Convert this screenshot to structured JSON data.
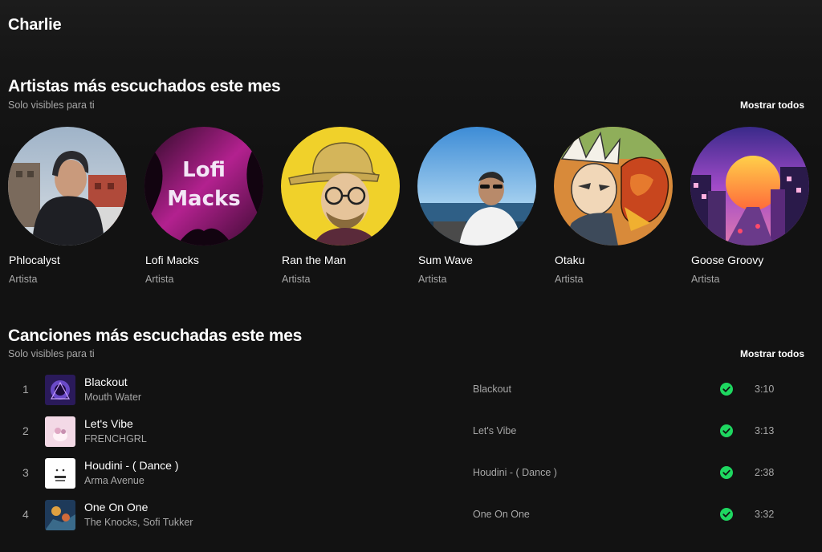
{
  "header": {
    "title": "Charlie"
  },
  "top_artists": {
    "title": "Artistas más escuchados este mes",
    "subtitle": "Solo visibles para ti",
    "show_all": "Mostrar todos",
    "items": [
      {
        "name": "Phlocalyst",
        "type": "Artista"
      },
      {
        "name": "Lofi Macks",
        "type": "Artista",
        "logo_text": [
          "Lofi",
          "Macks"
        ]
      },
      {
        "name": "Ran the Man",
        "type": "Artista"
      },
      {
        "name": "Sum Wave",
        "type": "Artista"
      },
      {
        "name": "Otaku",
        "type": "Artista"
      },
      {
        "name": "Goose Groovy",
        "type": "Artista"
      }
    ]
  },
  "top_tracks": {
    "title": "Canciones más escuchadas este mes",
    "subtitle": "Solo visibles para ti",
    "show_all": "Mostrar todos",
    "items": [
      {
        "num": "1",
        "title": "Blackout",
        "artist": "Mouth Water",
        "album": "Blackout",
        "duration": "3:10"
      },
      {
        "num": "2",
        "title": "Let's Vibe",
        "artist": "FRENCHGRL",
        "album": "Let's Vibe",
        "duration": "3:13"
      },
      {
        "num": "3",
        "title": "Houdini - ( Dance )",
        "artist": "Arma Avenue",
        "album": "Houdini - ( Dance )",
        "duration": "2:38"
      },
      {
        "num": "4",
        "title": "One On One",
        "artist": "The Knocks, Sofi Tukker",
        "album": "One On One",
        "duration": "3:32"
      }
    ]
  },
  "colors": {
    "background": "#121212",
    "accent_green": "#1ed760",
    "text_secondary": "#a7a7a7"
  }
}
